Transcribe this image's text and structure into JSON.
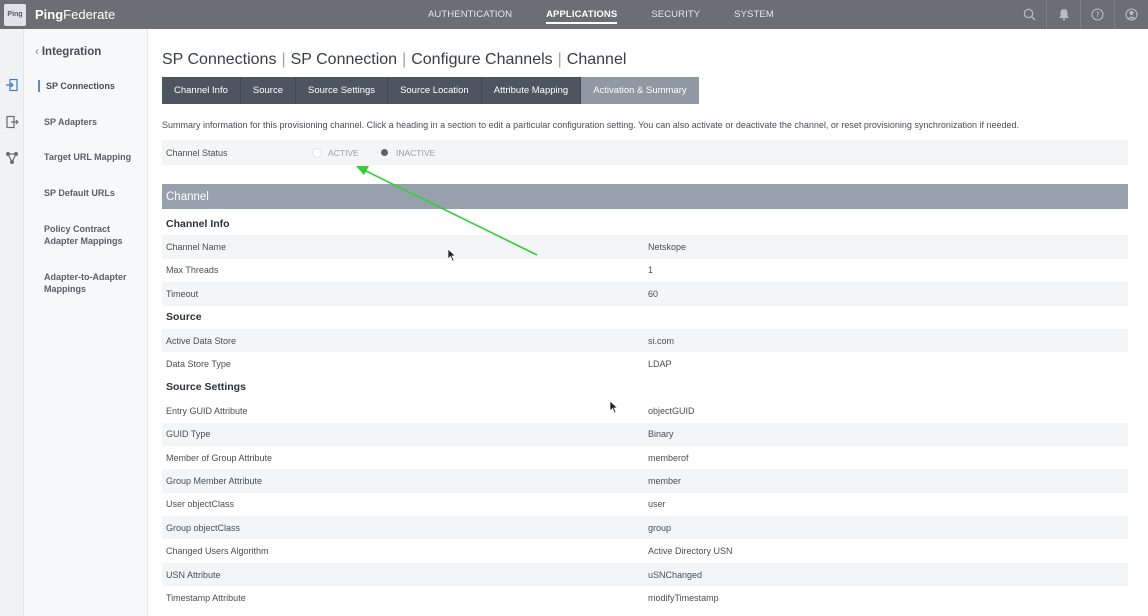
{
  "app": {
    "logo_text": "Ping",
    "brand_bold": "Ping",
    "brand_rest": "Federate"
  },
  "nav": {
    "items": [
      "AUTHENTICATION",
      "APPLICATIONS",
      "SECURITY",
      "SYSTEM"
    ],
    "active": "APPLICATIONS"
  },
  "top_icons": [
    "search-icon",
    "bell-icon",
    "help-icon",
    "user-icon"
  ],
  "sidebar": {
    "back_label": "Integration",
    "items": [
      {
        "label": "SP Connections",
        "active": true
      },
      {
        "label": "SP Adapters"
      },
      {
        "label": "Target URL Mapping"
      },
      {
        "label": "SP Default URLs"
      },
      {
        "label": "Policy Contract Adapter Mappings"
      },
      {
        "label": "Adapter-to-Adapter Mappings"
      }
    ]
  },
  "breadcrumb": [
    "SP Connections",
    "SP Connection",
    "Configure Channels",
    "Channel"
  ],
  "tabs": [
    "Channel Info",
    "Source",
    "Source Settings",
    "Source Location",
    "Attribute Mapping",
    "Activation & Summary"
  ],
  "active_tab": "Activation & Summary",
  "summary_text": "Summary information for this provisioning channel. Click a heading in a section to edit a particular configuration setting. You can also activate or deactivate the channel, or reset provisioning synchronization if needed.",
  "channel_status": {
    "label": "Channel Status",
    "options": [
      "ACTIVE",
      "INACTIVE"
    ],
    "selected": "INACTIVE"
  },
  "section_title": "Channel",
  "rows": [
    {
      "heading": "Channel Info"
    },
    {
      "key": "Channel Name",
      "value": "Netskope"
    },
    {
      "key": "Max Threads",
      "value": "1"
    },
    {
      "key": "Timeout",
      "value": "60"
    },
    {
      "heading": "Source"
    },
    {
      "key": "Active Data Store",
      "value": "si.com"
    },
    {
      "key": "Data Store Type",
      "value": "LDAP"
    },
    {
      "heading": "Source Settings"
    },
    {
      "key": "Entry GUID Attribute",
      "value": "objectGUID"
    },
    {
      "key": "GUID Type",
      "value": "Binary"
    },
    {
      "key": "Member of Group Attribute",
      "value": "memberof"
    },
    {
      "key": "Group Member Attribute",
      "value": "member"
    },
    {
      "key": "User objectClass",
      "value": "user"
    },
    {
      "key": "Group objectClass",
      "value": "group"
    },
    {
      "key": "Changed Users Algorithm",
      "value": "Active Directory USN"
    },
    {
      "key": "USN Attribute",
      "value": "uSNChanged"
    },
    {
      "key": "Timestamp Attribute",
      "value": "modifyTimestamp"
    }
  ],
  "colors": {
    "topbar": "#6b6e73",
    "tab": "#4d5660",
    "tab_active": "#8f98a3",
    "section_bar": "#97a1ad",
    "annotation_arrow": "#2fd12f"
  }
}
